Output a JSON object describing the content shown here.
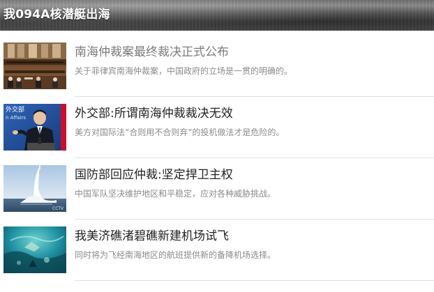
{
  "banner": {
    "title": "我094A核潜艇出海"
  },
  "articles": [
    {
      "headline": "南海仲裁案最终裁决正式公布",
      "summary": "关于菲律宾南海仲裁案，中国政府的立场是一贯的明确的。",
      "headline_color": "#7a7a7a",
      "thumbnail": "courtroom-photo"
    },
    {
      "headline": "外交部:所谓南海仲裁裁决无效",
      "summary": "美方对国际法“合则用不合则弃”的投机做法才是危险的。",
      "headline_color": "#222222",
      "thumbnail": "spokesperson-photo",
      "thumbnail_text": "外交部 / n Affairs"
    },
    {
      "headline": "国防部回应仲裁:坚定捍卫主权",
      "summary": "中国军队坚决维护地区和平稳定，应对各种威胁挑战。",
      "headline_color": "#222222",
      "thumbnail": "missile-launch-photo"
    },
    {
      "headline": "我美济礁渚碧礁新建机场试飞",
      "summary": "同时将为飞经南海地区的航班提供新的备降机场选择。",
      "headline_color": "#222222",
      "thumbnail": "reef-underwater-photo"
    }
  ]
}
